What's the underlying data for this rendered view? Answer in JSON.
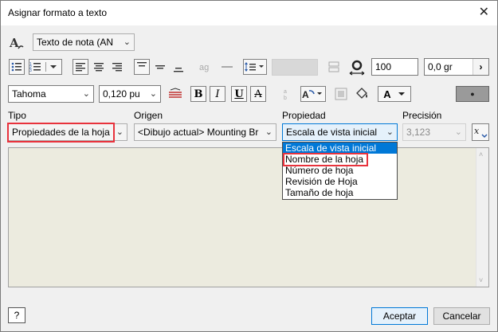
{
  "window": {
    "title": "Asignar formato a texto"
  },
  "style": {
    "value": "Texto de nota (AN"
  },
  "format": {
    "line_spacing_value": "100",
    "rotation_value": "0,0 gr",
    "font": "Tahoma",
    "font_size": "0,120 pu",
    "bold": "B",
    "italic": "I",
    "underline": "U",
    "strike": "A",
    "color_letter": "A"
  },
  "fields": {
    "tipo": {
      "label": "Tipo",
      "value": "Propiedades de la hoja"
    },
    "origen": {
      "label": "Origen",
      "value": "<Dibujo actual> Mounting Br"
    },
    "propiedad": {
      "label": "Propiedad",
      "value": "Escala de vista inicial"
    },
    "precision": {
      "label": "Precisión",
      "value": "3,123"
    }
  },
  "dropdown": {
    "items": [
      "Escala de vista inicial",
      "Nombre de la hoja",
      "Número de hoja",
      "Revisión de Hoja",
      "Tamaño de hoja"
    ],
    "selected_index": 0,
    "highlighted_index": 1
  },
  "footer": {
    "help": "?",
    "ok": "Aceptar",
    "cancel": "Cancelar"
  },
  "colors": {
    "highlight": "#e8323c",
    "selection": "#0078d7",
    "text_area": "#ecebdf"
  }
}
